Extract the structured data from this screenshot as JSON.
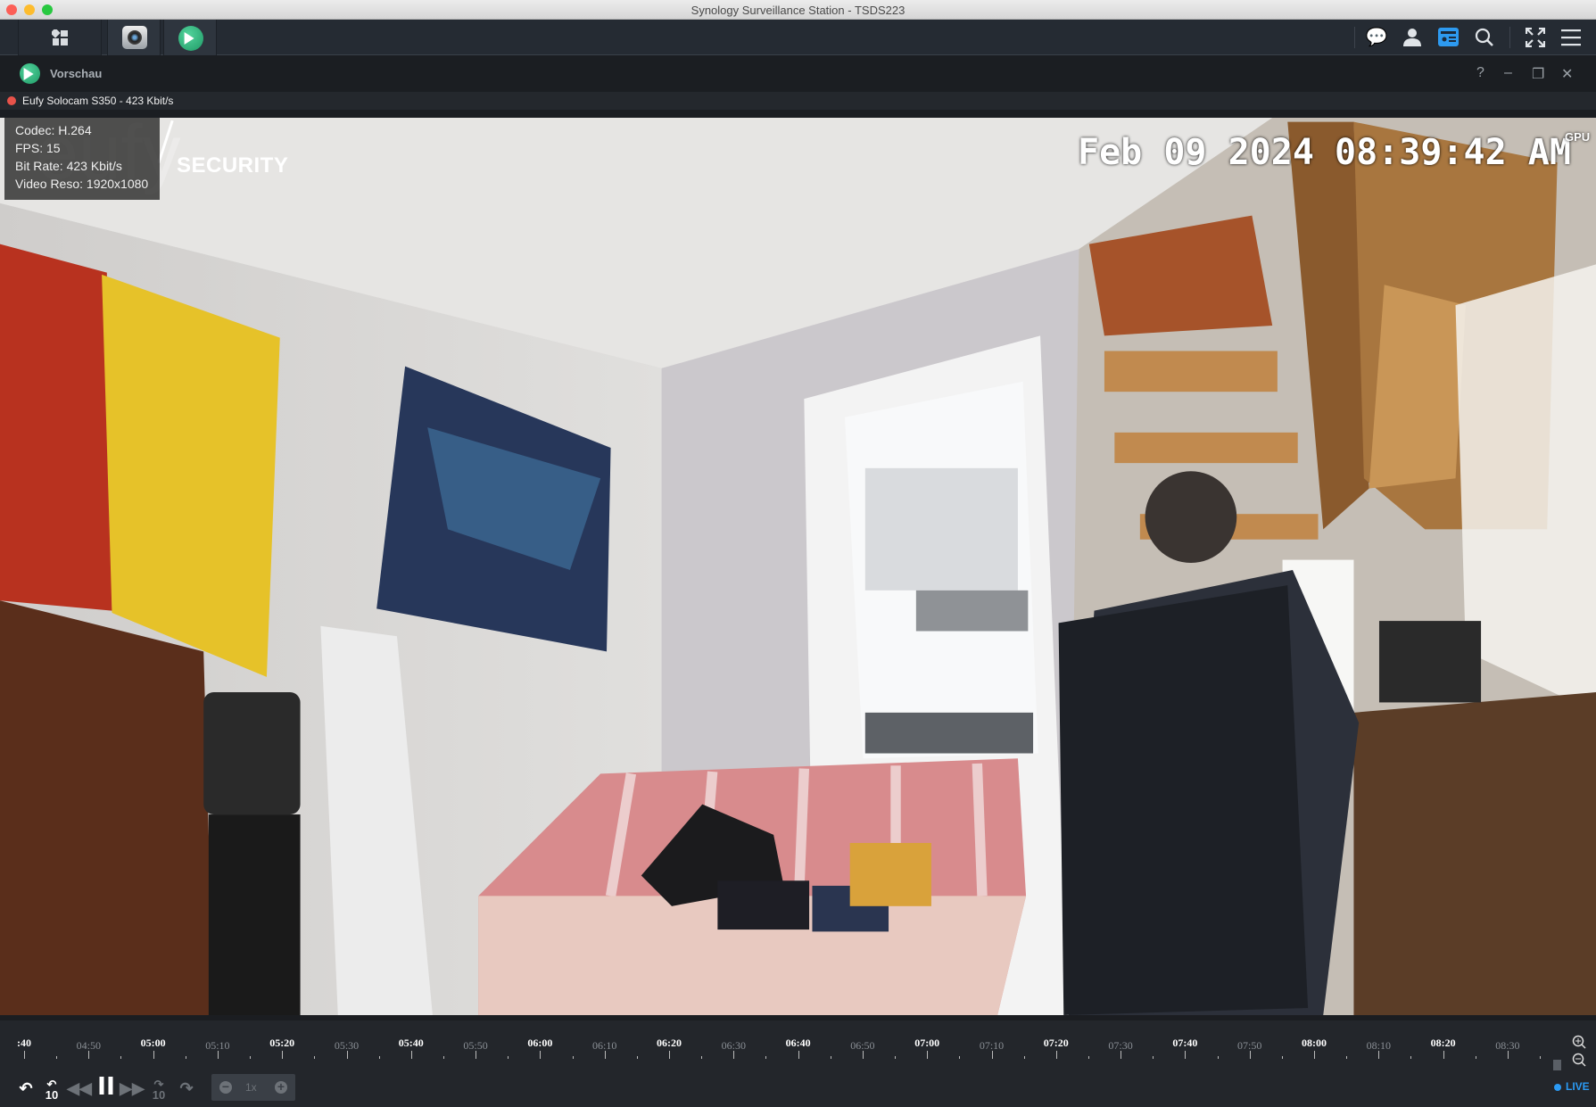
{
  "window": {
    "title": "Synology Surveillance Station - TSDS223"
  },
  "toolbar": {
    "tabs": [
      {
        "icon": "grid-icon"
      },
      {
        "icon": "camera-icon"
      },
      {
        "icon": "play-icon"
      }
    ],
    "right_icons": [
      "chat-icon",
      "user-icon",
      "widget-icon",
      "search-icon",
      "fullscreen-icon",
      "menu-icon"
    ]
  },
  "app_window": {
    "title": "Vorschau",
    "help": "?",
    "minimize": "–",
    "restore": "❐",
    "close": "✕"
  },
  "camera": {
    "label": "Eufy Solocam S350 - 423 Kbit/s",
    "status_color": "#e8534a"
  },
  "stream_info": {
    "codec": "Codec: H.264",
    "fps": "FPS: 15",
    "bitrate": "Bit Rate: 423 Kbit/s",
    "resolution": "Video Reso: 1920x1080"
  },
  "overlay": {
    "logo_text": "eufy",
    "logo_sub": "SECURITY",
    "date": "Feb 09 2024",
    "time": "08:39:42 AM",
    "gpu": "GPU"
  },
  "timeline": {
    "labels": [
      ":40",
      "04:50",
      "05:00",
      "05:10",
      "05:20",
      "05:30",
      "05:40",
      "05:50",
      "06:00",
      "06:10",
      "06:20",
      "06:30",
      "06:40",
      "06:50",
      "07:00",
      "07:10",
      "07:20",
      "07:30",
      "07:40",
      "07:50",
      "08:00",
      "08:10",
      "08:20",
      "08:30"
    ]
  },
  "controls": {
    "skip_back_10": "10",
    "skip_fwd_10": "10",
    "speed": "1x",
    "live": "LIVE",
    "accent": "#2b9af3"
  }
}
